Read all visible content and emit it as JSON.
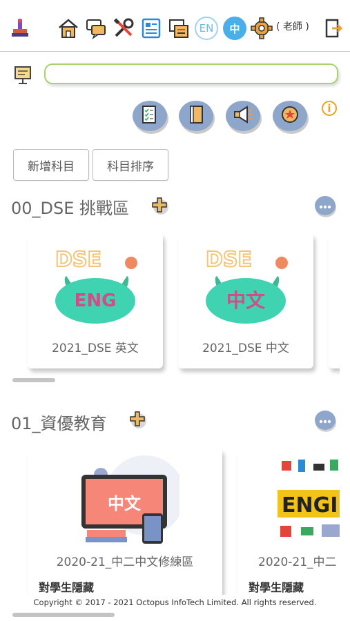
{
  "header": {
    "icons": [
      "tool-icon",
      "home-icon",
      "chat-icon",
      "tools-icon",
      "notes-icon",
      "message-board-icon"
    ],
    "lang_en": "EN",
    "lang_zh": "中",
    "role": "( 老師 )",
    "colors": {
      "accent": "#4aaee8",
      "lang_outline": "#9dd2f0"
    }
  },
  "search": {
    "value": "",
    "placeholder": ""
  },
  "actions": {
    "icons": [
      "report-icon",
      "book-icon",
      "megaphone-icon",
      "star-badge-icon"
    ],
    "info": "i"
  },
  "buttons": {
    "add_subject": "新增科目",
    "sort_subject": "科目排序"
  },
  "sections": [
    {
      "title": "00_DSE 挑戰區",
      "cards": [
        {
          "label": "2021_DSE 英文",
          "logo_top": "DSE",
          "logo_main": "ENG"
        },
        {
          "label": "2021_DSE 中文",
          "logo_top": "DSE",
          "logo_main": "中文"
        }
      ]
    },
    {
      "title": "01_資優教育",
      "cards": [
        {
          "label": "2020-21_中二中文修練區",
          "logo_main": "中文",
          "status": "對學生隱藏"
        },
        {
          "label": "2020-21_中二",
          "logo_main": "ENGI",
          "status": "對學生隱藏"
        }
      ]
    }
  ],
  "footer": {
    "copyright": "Copyright © 2017 - 2021 Octopus InfoTech Limited. All rights reserved."
  }
}
